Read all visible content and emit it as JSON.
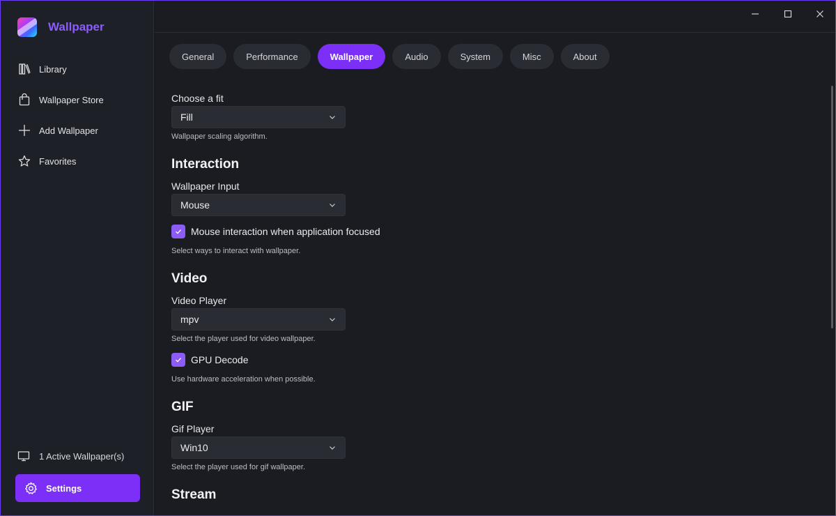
{
  "app": {
    "title": "Wallpaper",
    "accent": "#7b2ff7"
  },
  "sidebar": {
    "items": [
      {
        "label": "Library",
        "icon": "library-icon"
      },
      {
        "label": "Wallpaper Store",
        "icon": "shopping-bag-icon"
      },
      {
        "label": "Add Wallpaper",
        "icon": "plus-icon"
      },
      {
        "label": "Favorites",
        "icon": "star-icon"
      }
    ],
    "active_wallpapers": "1 Active Wallpaper(s)",
    "settings_label": "Settings"
  },
  "tabs": [
    {
      "label": "General"
    },
    {
      "label": "Performance"
    },
    {
      "label": "Wallpaper",
      "active": true
    },
    {
      "label": "Audio"
    },
    {
      "label": "System"
    },
    {
      "label": "Misc"
    },
    {
      "label": "About"
    }
  ],
  "settings": {
    "fit": {
      "label": "Choose a fit",
      "value": "Fill",
      "hint": "Wallpaper scaling algorithm."
    },
    "interaction": {
      "heading": "Interaction",
      "input_label": "Wallpaper Input",
      "input_value": "Mouse",
      "mouse_focus_label": "Mouse interaction when application focused",
      "mouse_focus_checked": true,
      "hint": "Select ways to interact with wallpaper."
    },
    "video": {
      "heading": "Video",
      "player_label": "Video Player",
      "player_value": "mpv",
      "player_hint": "Select the player used for video wallpaper.",
      "gpu_label": "GPU Decode",
      "gpu_checked": true,
      "gpu_hint": "Use hardware acceleration when possible."
    },
    "gif": {
      "heading": "GIF",
      "player_label": "Gif Player",
      "player_value": "Win10",
      "player_hint": "Select the player used for gif wallpaper."
    },
    "stream": {
      "heading": "Stream"
    }
  }
}
